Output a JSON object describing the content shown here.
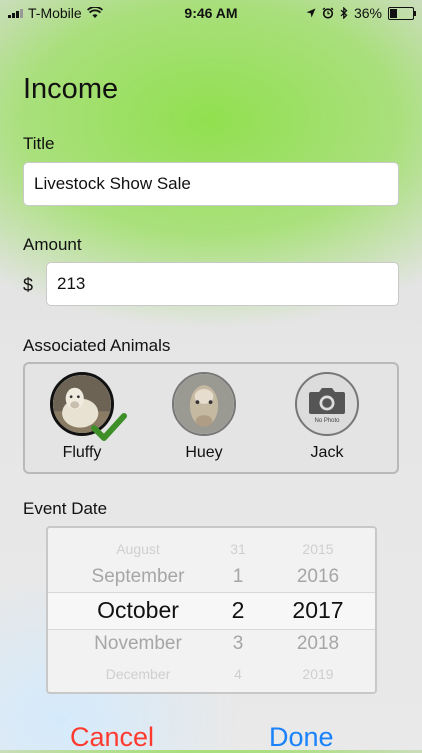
{
  "status_bar": {
    "carrier": "T-Mobile",
    "time": "9:46 AM",
    "battery": "36%",
    "battery_level": 0.36
  },
  "form": {
    "heading": "Income",
    "title_label": "Title",
    "title_value": "Livestock Show Sale",
    "amount_label": "Amount",
    "currency_symbol": "$",
    "amount_value": "213",
    "animals_label": "Associated Animals",
    "animals": [
      {
        "name": "Fluffy",
        "selected": true
      },
      {
        "name": "Huey",
        "selected": false
      },
      {
        "name": "Jack",
        "selected": false,
        "placeholder_text": "No Photo"
      }
    ],
    "date_label": "Event Date"
  },
  "date_picker": {
    "rows": [
      {
        "month": "August",
        "day": "31",
        "year": "2015"
      },
      {
        "month": "September",
        "day": "1",
        "year": "2016"
      },
      {
        "month": "October",
        "day": "2",
        "year": "2017"
      },
      {
        "month": "November",
        "day": "3",
        "year": "2018"
      },
      {
        "month": "December",
        "day": "4",
        "year": "2019"
      }
    ],
    "selected_index": 2
  },
  "actions": {
    "cancel": "Cancel",
    "done": "Done"
  },
  "colors": {
    "cancel": "#ff3b30",
    "done": "#1a82fb",
    "check": "#3f8f29",
    "accent_green": "#8de048"
  }
}
